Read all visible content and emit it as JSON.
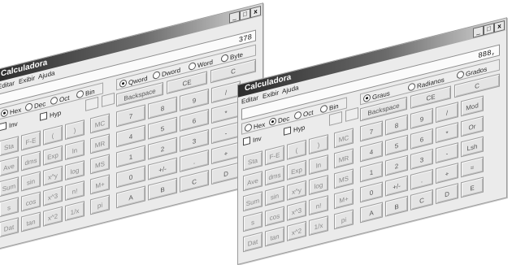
{
  "left": {
    "title": "Calculadora",
    "menu": [
      "Editar",
      "Exibir",
      "Ajuda"
    ],
    "display": "378",
    "size_modes": [
      "Qword",
      "Dword",
      "Word",
      "Byte"
    ],
    "base_modes": [
      "Hex",
      "Dec",
      "Oct",
      "Bin"
    ],
    "checks": [
      "Inv",
      "Hyp"
    ],
    "top_buttons": [
      "Backspace",
      "CE",
      "C"
    ],
    "sci_buttons": [
      "Sta",
      "F-E",
      "(",
      ")",
      "Ave",
      "dms",
      "Exp",
      "ln",
      "Sum",
      "sin",
      "x^y",
      "log",
      "s",
      "cos",
      "x^3",
      "n!",
      "Dat",
      "tan",
      "x^2",
      "1/x"
    ],
    "mem_buttons": [
      "MC",
      "MR",
      "MS",
      "M+",
      "pi"
    ],
    "num_buttons": [
      "7",
      "8",
      "9",
      "/",
      "4",
      "5",
      "6",
      "*",
      "1",
      "2",
      "3",
      "-",
      "0",
      "+/-",
      ".",
      "+",
      "A",
      "B",
      "C",
      "D"
    ]
  },
  "right": {
    "title": "Calculadora",
    "menu": [
      "Editar",
      "Exibir",
      "Ajuda"
    ],
    "display": "888,",
    "angle_modes": [
      "Graus",
      "Radianos",
      "Grados"
    ],
    "base_modes": [
      "Hex",
      "Dec",
      "Oct",
      "Bin"
    ],
    "checks": [
      "Inv",
      "Hyp"
    ],
    "top_buttons": [
      "Backspace",
      "CE",
      "C"
    ],
    "sci_buttons": [
      "Sta",
      "F-E",
      "(",
      ")",
      "Ave",
      "dms",
      "Exp",
      "ln",
      "Sum",
      "sin",
      "x^y",
      "log",
      "s",
      "cos",
      "x^3",
      "n!",
      "Dat",
      "tan",
      "x^2",
      "1/x"
    ],
    "mem_buttons": [
      "MC",
      "MR",
      "MS",
      "M+",
      "pi"
    ],
    "num_buttons": [
      "7",
      "8",
      "9",
      "/",
      "Mod",
      "4",
      "5",
      "6",
      "*",
      "Or",
      "1",
      "2",
      "3",
      "-",
      "Lsh",
      "0",
      "+/-",
      ".",
      "+",
      "=",
      "A",
      "B",
      "C",
      "D",
      "E"
    ]
  }
}
